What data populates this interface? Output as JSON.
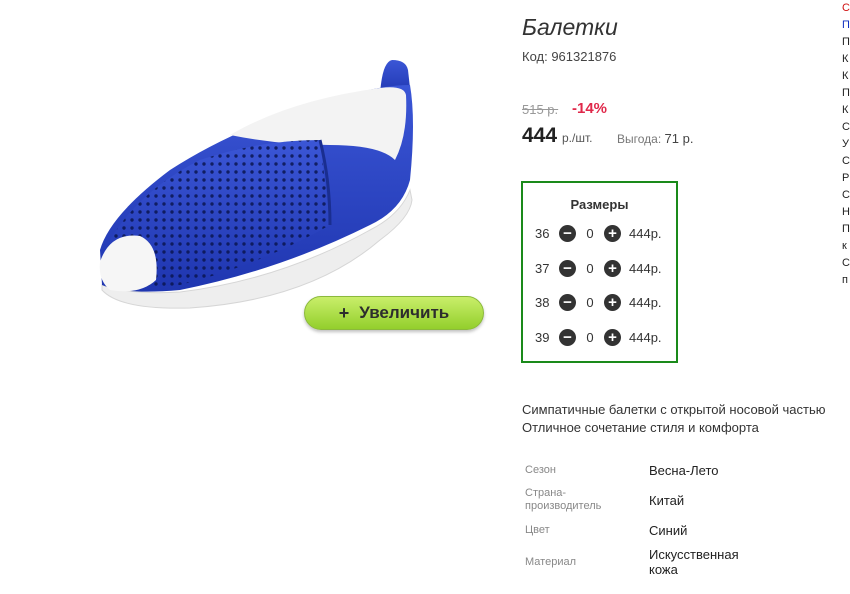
{
  "product": {
    "title": "Балетки",
    "code": "Код: 961321876",
    "old_price": "515 р.",
    "discount": "-14%",
    "price": "444",
    "price_unit": "р./шт.",
    "benefit_label": "Выгода:",
    "benefit_value": "71 р.",
    "zoom_button": "Увеличить",
    "zoom_plus": "+"
  },
  "sizes": {
    "title": "Размеры",
    "rows": [
      {
        "size": "36",
        "qty": "0",
        "price": "444р."
      },
      {
        "size": "37",
        "qty": "0",
        "price": "444р."
      },
      {
        "size": "38",
        "qty": "0",
        "price": "444р."
      },
      {
        "size": "39",
        "qty": "0",
        "price": "444р."
      }
    ]
  },
  "description": {
    "line1": "Симпатичные балетки с открытой носовой частью",
    "line2": "Отличное сочетание стиля и комфорта"
  },
  "specs": [
    {
      "label": "Сезон",
      "value": "Весна-Лето"
    },
    {
      "label": "Страна-производитель",
      "value": "Китай"
    },
    {
      "label": "Цвет",
      "value": "Синий"
    },
    {
      "label": "Материал",
      "value": "Искусственная кожа"
    }
  ],
  "side_letters": [
    "С",
    "П",
    "П",
    "К",
    "К",
    "П",
    "К",
    "С",
    "У",
    "С",
    "Р",
    "С",
    "Н",
    "П",
    "к",
    "С",
    "п"
  ],
  "colors": {
    "shoe_blue": "#2f48c8",
    "accent_green": "#1a8a1a",
    "discount_red": "#e0284a",
    "button_green": "#a6dc3c"
  }
}
